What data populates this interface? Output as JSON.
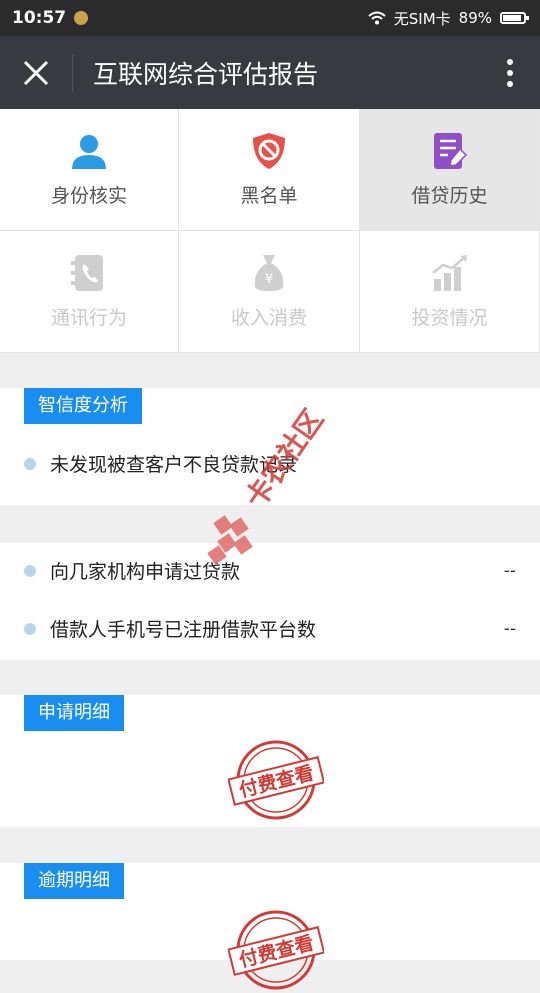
{
  "status_bar": {
    "time": "10:57",
    "sim": "无SIM卡",
    "battery": "89%",
    "battery_level": 0.89
  },
  "header": {
    "title": "互联网综合评估报告"
  },
  "grid": [
    {
      "label": "身份核实",
      "icon": "person-icon",
      "color": "#2b9be6",
      "active": false,
      "disabled": false
    },
    {
      "label": "黑名单",
      "icon": "shield-block-icon",
      "color": "#e8514b",
      "active": false,
      "disabled": false
    },
    {
      "label": "借贷历史",
      "icon": "notepad-icon",
      "color": "#8f4fc9",
      "active": true,
      "disabled": false
    },
    {
      "label": "通讯行为",
      "icon": "phone-book-icon",
      "color": "#c9c9c9",
      "active": false,
      "disabled": true
    },
    {
      "label": "收入消费",
      "icon": "money-bag-icon",
      "color": "#c9c9c9",
      "active": false,
      "disabled": true
    },
    {
      "label": "投资情况",
      "icon": "chart-growth-icon",
      "color": "#c9c9c9",
      "active": false,
      "disabled": true
    }
  ],
  "sections": {
    "credit_analysis": {
      "tag": "智信度分析",
      "items": [
        {
          "text": "未发现被查客户不良贷款记录"
        }
      ]
    },
    "applications": {
      "items": [
        {
          "text": "向几家机构申请过贷款",
          "value": "--"
        },
        {
          "text": "借款人手机号已注册借款平台数",
          "value": "--"
        }
      ]
    },
    "apply_detail": {
      "tag": "申请明细",
      "stamp": "付费查看"
    },
    "overdue_detail": {
      "tag": "逾期明细",
      "stamp": "付费查看"
    }
  },
  "watermark": {
    "text": "卡农社区"
  },
  "colors": {
    "accent": "#1a8ef0",
    "stamp": "#d23a35",
    "header_bg": "#393a3f",
    "status_bg": "#2b2b2b"
  }
}
